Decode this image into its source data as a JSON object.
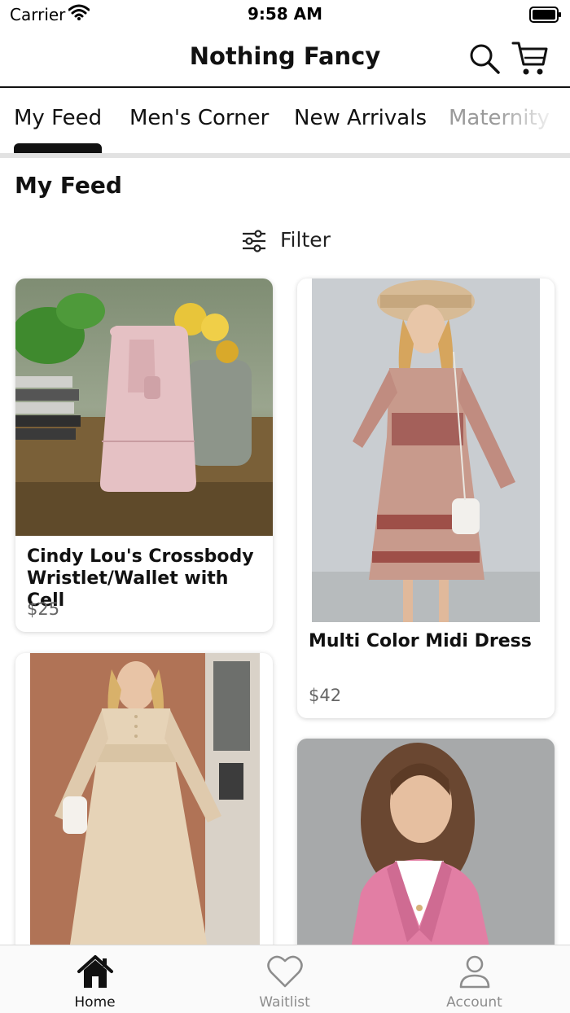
{
  "status_bar": {
    "carrier": "Carrier",
    "time": "9:58 AM"
  },
  "header": {
    "title": "Nothing Fancy",
    "search_icon": "search-icon",
    "cart_icon": "cart-icon"
  },
  "tabs": [
    {
      "label": "My Feed",
      "active": true
    },
    {
      "label": "Men's Corner",
      "active": false
    },
    {
      "label": "New Arrivals",
      "active": false
    },
    {
      "label": "Maternity",
      "active": false
    }
  ],
  "feed": {
    "title": "My Feed",
    "filter_label": "Filter"
  },
  "products": [
    {
      "name": "Cindy Lou's Crossbody Wristlet/Wallet with Cell",
      "price": "$25",
      "image": "pink crossbody wallet photo"
    },
    {
      "name": "Multi Color Midi Dress",
      "price": "$42",
      "image": "floral midi dress photo"
    },
    {
      "name": "",
      "price": "",
      "image": "beige long dress photo"
    },
    {
      "name": "",
      "price": "",
      "image": "pink blazer photo"
    }
  ],
  "bottom_nav": [
    {
      "label": "Home",
      "icon": "home-icon",
      "active": true
    },
    {
      "label": "Waitlist",
      "icon": "heart-icon",
      "active": false
    },
    {
      "label": "Account",
      "icon": "person-icon",
      "active": false
    }
  ],
  "colors": {
    "text": "#111111",
    "inactive": "#8d8d8d",
    "divider": "#e2e2e2",
    "price": "#666666"
  }
}
